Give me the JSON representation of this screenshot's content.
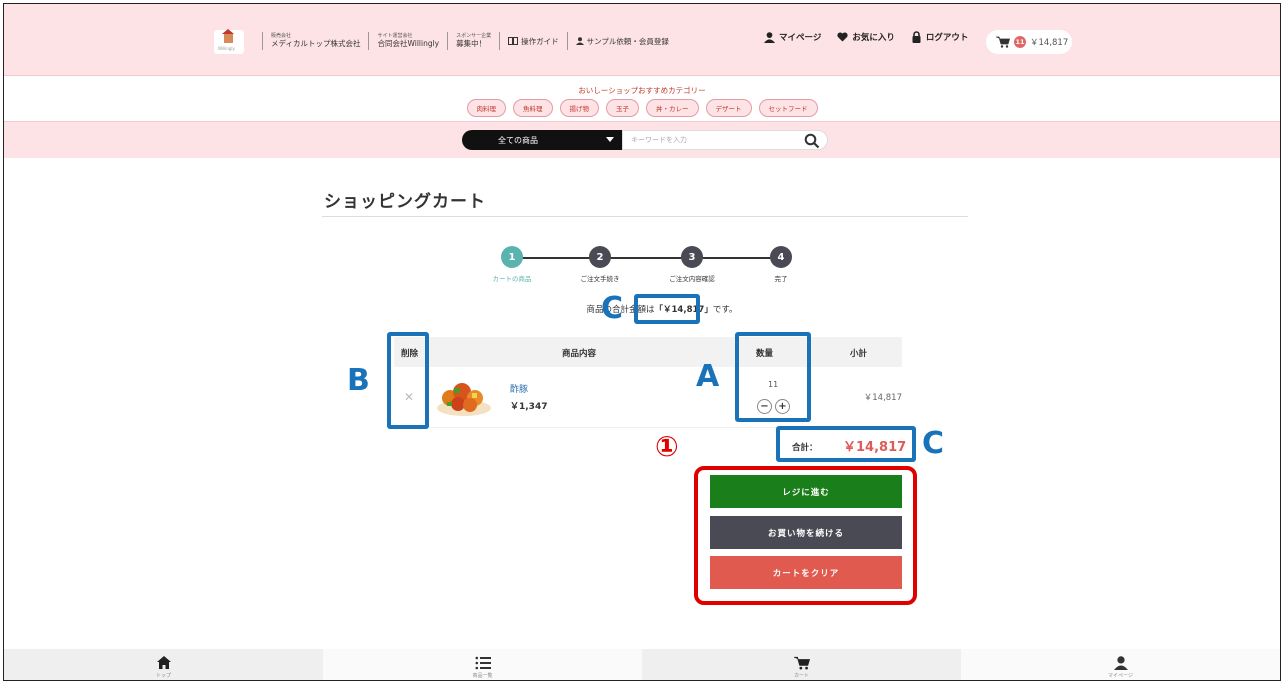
{
  "header": {
    "company1_small": "販売会社",
    "company1_name": "メディカルトップ株式会社",
    "company2_small": "サイト運営会社",
    "company2_name": "合同会社Willingly",
    "sponsor_small": "スポンサー企業",
    "sponsor_name": "募集中！",
    "guide_link": "操作ガイド",
    "sample_link": "サンプル依頼・会員登録",
    "mypage": "マイページ",
    "favorites": "お気に入り",
    "logout": "ログアウト",
    "cart_count": "11",
    "cart_total": "￥14,817"
  },
  "categories": {
    "title": "おいしーショップおすすめカテゴリー",
    "items": [
      "肉料理",
      "魚料理",
      "揚げ物",
      "玉子",
      "丼・カレー",
      "デザート",
      "セットフード"
    ]
  },
  "search": {
    "select_value": "全ての商品",
    "placeholder": "キーワードを入力"
  },
  "page": {
    "title": "ショッピングカート"
  },
  "steps": [
    {
      "num": "1",
      "label": "カートの商品"
    },
    {
      "num": "2",
      "label": "ご注文手続き"
    },
    {
      "num": "3",
      "label": "ご注文内容確認"
    },
    {
      "num": "4",
      "label": "完了"
    }
  ],
  "summary": {
    "prefix": "商品の合計金額は",
    "amount": "「￥14,817」",
    "suffix": "です。"
  },
  "table": {
    "headers": {
      "delete": "削除",
      "content": "商品内容",
      "qty": "数量",
      "subtotal": "小計"
    },
    "rows": [
      {
        "name": "酢豚",
        "price": "￥1,347",
        "qty": "11",
        "subtotal": "￥14,817"
      }
    ]
  },
  "total": {
    "label": "合計：",
    "amount": "￥14,817"
  },
  "buttons": {
    "checkout": "レジに進む",
    "continue": "お買い物を続ける",
    "clear": "カートをクリア"
  },
  "annotations": {
    "a": "A",
    "b": "B",
    "c1": "C",
    "c2": "C",
    "num1": "①"
  },
  "bottom_nav": [
    {
      "label": "トップ",
      "icon": "home-icon"
    },
    {
      "label": "商品一覧",
      "icon": "list-icon"
    },
    {
      "label": "カート",
      "icon": "cart-icon"
    },
    {
      "label": "マイページ",
      "icon": "user-icon"
    }
  ],
  "colors": {
    "header_bg": "#fde3e6",
    "accent_step": "#5ab3ae",
    "checkout": "#1a7f1a",
    "continue": "#4a4a55",
    "clear": "#e05a50",
    "price_red": "#e05a5a",
    "annotation_blue": "#1a73b9",
    "annotation_red": "#e00000"
  }
}
